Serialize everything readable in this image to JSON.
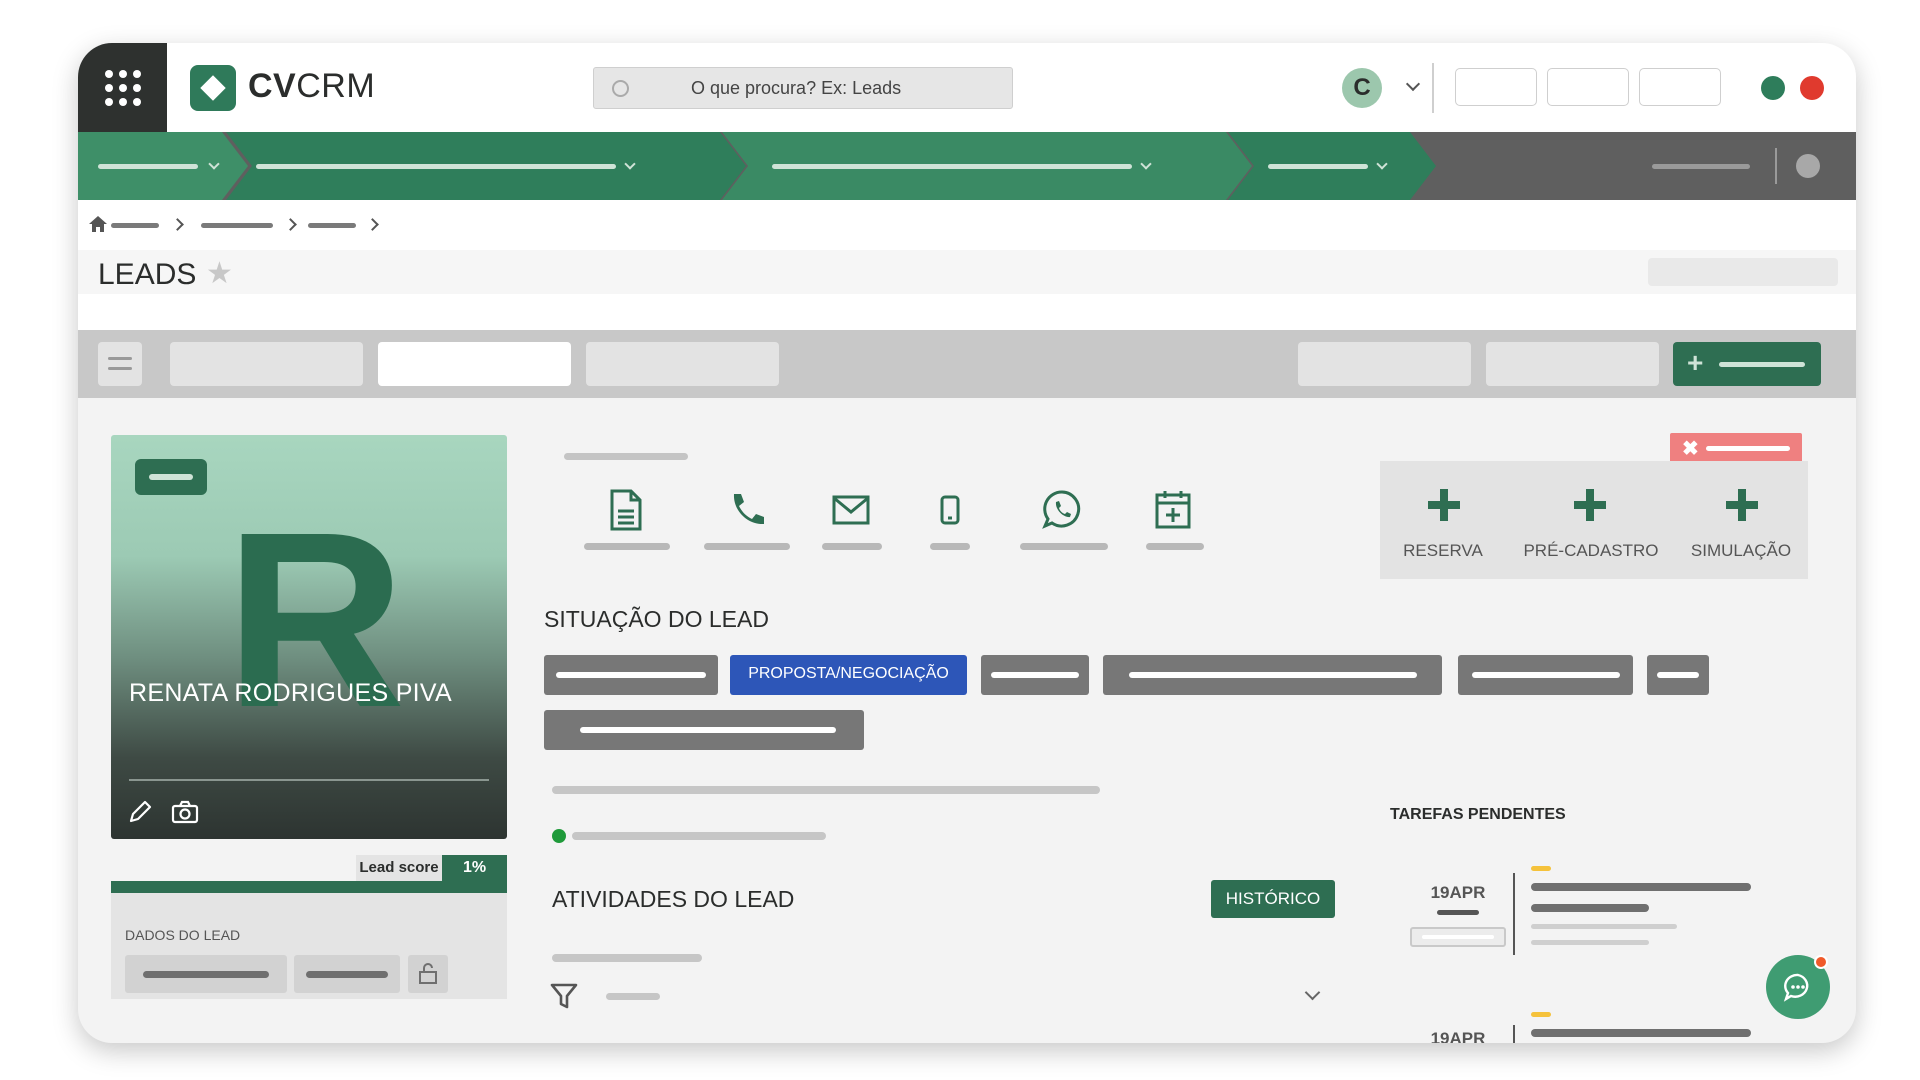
{
  "header": {
    "logo_text_bold": "CV",
    "logo_text_light": "CRM",
    "search_placeholder": "O que procura? Ex: Leads",
    "avatar_initial": "C",
    "status_colors": [
      "#2e7d5b",
      "#e03a2e"
    ]
  },
  "page": {
    "title": "LEADS",
    "favorite_icon": "star-icon"
  },
  "lead": {
    "initial": "R",
    "name": "RENATA RODRIGUES PIVA",
    "lead_score_label": "Lead score",
    "lead_score_value": "1%",
    "data_section_label": "DADOS DO LEAD"
  },
  "actions": {
    "icons": [
      "document-icon",
      "phone-icon",
      "email-icon",
      "mobile-icon",
      "whatsapp-icon",
      "calendar-add-icon"
    ]
  },
  "quick_actions": [
    {
      "label": "RESERVA"
    },
    {
      "label": "PRÉ-CADASTRO"
    },
    {
      "label": "SIMULAÇÃO"
    }
  ],
  "situacao": {
    "title": "SITUAÇÃO DO LEAD",
    "active_stage": "PROPOSTA/NEGOCIAÇÃO"
  },
  "atividades": {
    "title": "ATIVIDADES DO LEAD",
    "history_button": "HISTÓRICO"
  },
  "tarefas": {
    "title": "TAREFAS PENDENTES",
    "items": [
      {
        "date": "19APR"
      },
      {
        "date": "19APR"
      }
    ]
  },
  "colors": {
    "brand_green": "#2e6e52",
    "active_stage_blue": "#2d56b8",
    "danger_red": "#ef8080"
  }
}
